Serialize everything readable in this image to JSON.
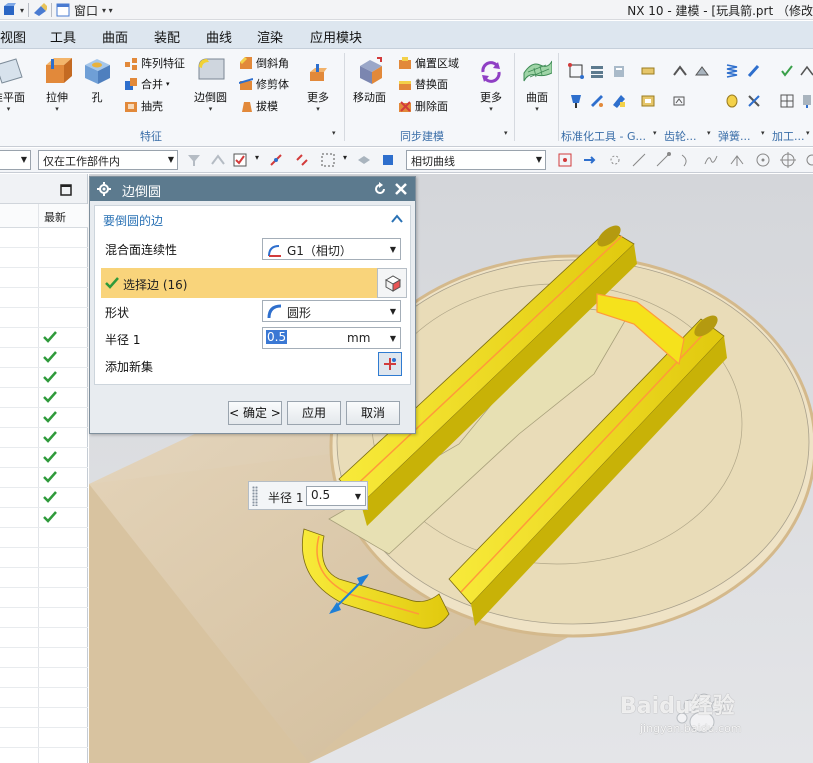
{
  "app": {
    "title": "NX 10 - 建模 - [玩具箭.prt （修改",
    "window_menu_label": "窗口"
  },
  "menubar": {
    "items": [
      "视图",
      "工具",
      "曲面",
      "装配",
      "曲线",
      "渲染",
      "应用模块"
    ]
  },
  "ribbon": {
    "groups": {
      "feature": "特征",
      "sync": "同步建模",
      "std_tools": "标准化工具 - G...",
      "gear": "齿轮...",
      "spring": "弹簧...",
      "machining": "加工..."
    },
    "buttons": {
      "datum_plane": "准平面",
      "extrude": "拉伸",
      "hole": "孔",
      "pattern": "阵列特征",
      "combine": "合并",
      "shell": "抽壳",
      "edge_blend": "边倒圆",
      "chamfer": "倒斜角",
      "trim_body": "修剪体",
      "draft": "拔模",
      "more_feature": "更多",
      "move_face": "移动面",
      "offset_region": "偏置区域",
      "replace_face": "替换面",
      "delete_face": "删除面",
      "more_sync": "更多",
      "surface": "曲面"
    }
  },
  "selection_bar": {
    "scope": "仅在工作部件内",
    "curve_rule": "相切曲线"
  },
  "navigator": {
    "col_latest": "最新",
    "checked_rows": 10
  },
  "dialog": {
    "title": "边倒圆",
    "section_title": "要倒圆的边",
    "continuity_label": "混合面连续性",
    "continuity_value": "G1（相切）",
    "select_edge_label": "选择边 (16)",
    "shape_label": "形状",
    "shape_value": "圆形",
    "radius_label": "半径 1",
    "radius_value": "0.5",
    "radius_unit": "mm",
    "add_new_set_label": "添加新集",
    "ok_button": "< 确定 >",
    "apply_button": "应用",
    "cancel_button": "取消"
  },
  "onscreen_radius": {
    "label": "半径 1",
    "value": "0.5"
  },
  "watermark": {
    "brand": "Baidu经验",
    "url": "jingyan.baidu.com"
  },
  "colors": {
    "menu_bg": "#dde6ef",
    "dialog_title_bg": "#5c7a8e",
    "selected_row_bg": "#f9d47b",
    "model_yellow": "#f5e21c",
    "ribbon_group_label": "#3a6ea8"
  }
}
